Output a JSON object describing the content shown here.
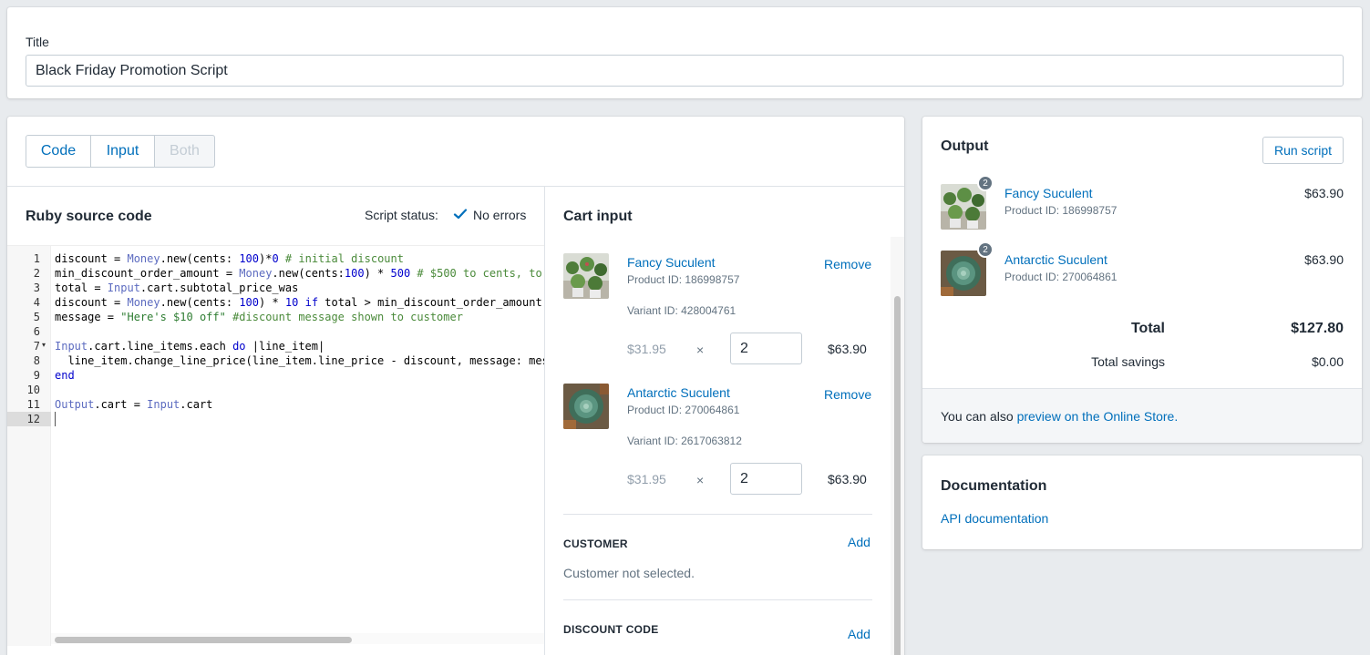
{
  "title_card": {
    "label": "Title",
    "value": "Black Friday Promotion Script"
  },
  "view_toggle": {
    "options": [
      "Code",
      "Input",
      "Both"
    ],
    "selected": "Both"
  },
  "code_pane": {
    "heading": "Ruby source code",
    "status_label": "Script status:",
    "status_value": "No errors",
    "line_numbers": [
      "1",
      "2",
      "3",
      "4",
      "5",
      "6",
      "7",
      "8",
      "9",
      "10",
      "11",
      "12"
    ],
    "active_line": "12"
  },
  "cart_input": {
    "heading": "Cart input",
    "items": [
      {
        "name": "Fancy Suculent",
        "product_id": "Product ID: 186998757",
        "variant_id": "Variant ID: 428004761",
        "remove_label": "Remove",
        "unit_price": "$31.95",
        "times": "×",
        "quantity": "2",
        "line_total": "$63.90"
      },
      {
        "name": "Antarctic Suculent",
        "product_id": "Product ID: 270064861",
        "variant_id": "Variant ID: 2617063812",
        "remove_label": "Remove",
        "unit_price": "$31.95",
        "times": "×",
        "quantity": "2",
        "line_total": "$63.90"
      }
    ],
    "customer": {
      "title": "CUSTOMER",
      "add_label": "Add",
      "note": "Customer not selected."
    },
    "discount_code": {
      "title": "DISCOUNT CODE",
      "add_label": "Add"
    }
  },
  "output": {
    "heading": "Output",
    "run_label": "Run script",
    "items": [
      {
        "badge": "2",
        "name": "Fancy Suculent",
        "product_id": "Product ID: 186998757",
        "price": "$63.90"
      },
      {
        "badge": "2",
        "name": "Antarctic Suculent",
        "product_id": "Product ID: 270064861",
        "price": "$63.90"
      }
    ],
    "total_label": "Total",
    "total_value": "$127.80",
    "savings_label": "Total savings",
    "savings_value": "$0.00",
    "preview_prefix": "You can also ",
    "preview_link": "preview on the Online Store."
  },
  "documentation": {
    "heading": "Documentation",
    "link": "API documentation"
  },
  "colors": {
    "link": "#006fbb",
    "background": "#e8ebee",
    "badge": "#637381",
    "check": "#006fbb"
  }
}
